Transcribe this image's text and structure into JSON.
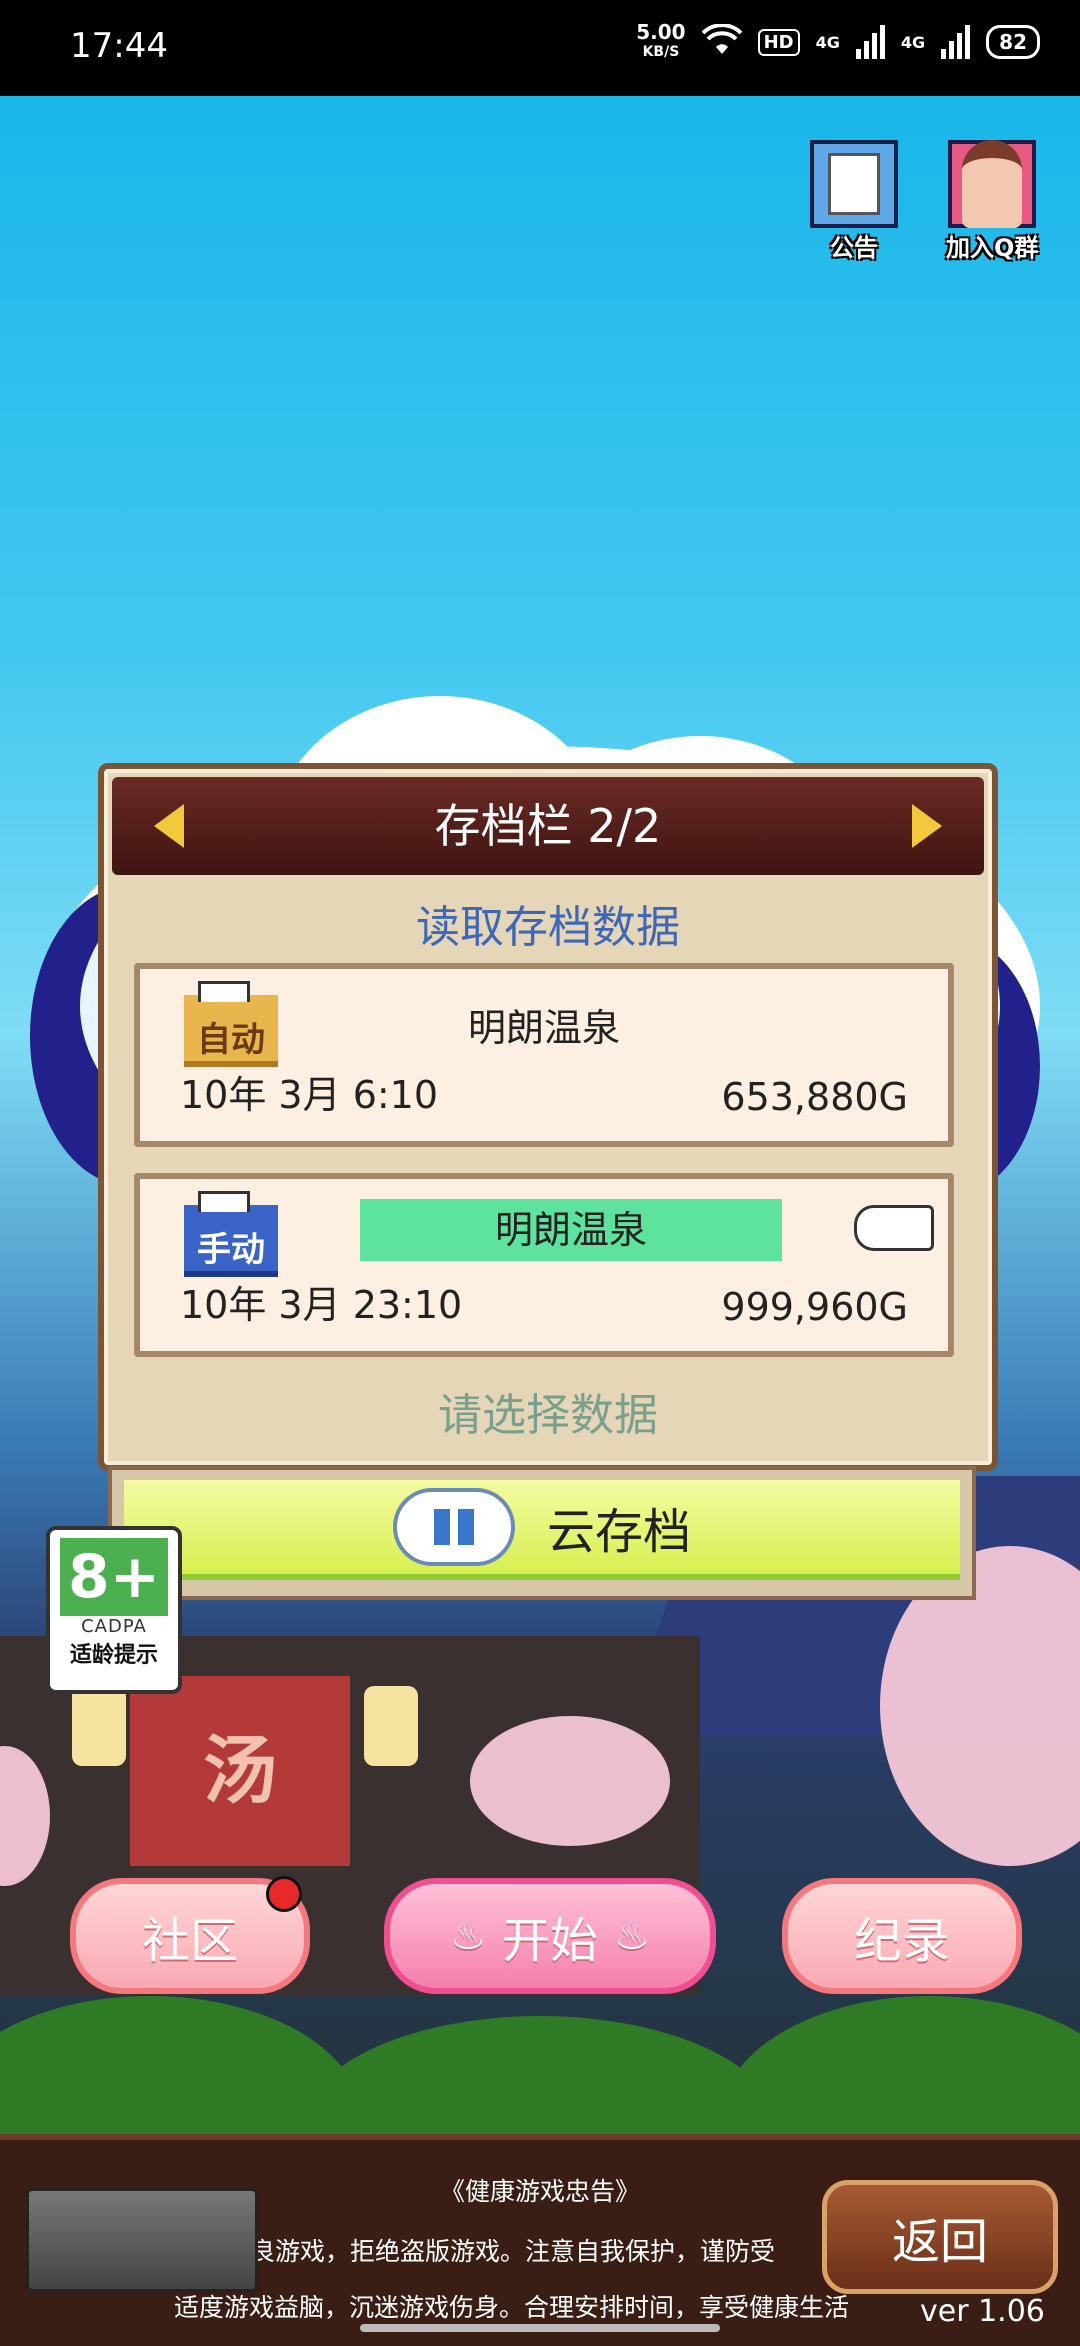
{
  "status_bar": {
    "time": "17:44",
    "net_speed_value": "5.00",
    "net_speed_unit": "KB/S",
    "hd_label": "HD",
    "signal_1": "4G",
    "signal_2": "4G",
    "battery": "82"
  },
  "top_icons": {
    "announcement_label": "公告",
    "join_qq_label": "加入Q群"
  },
  "save_panel": {
    "title": "存档栏 2/2",
    "subtitle": "读取存档数据",
    "slots": [
      {
        "badge": "自动",
        "name": "明朗温泉",
        "date": "10年 3月   6:10",
        "money": "653,880G"
      },
      {
        "badge": "手动",
        "name": "明朗温泉",
        "date": "10年 3月 23:10",
        "money": "999,960G"
      }
    ],
    "prompt": "请选择数据"
  },
  "cloud_save": {
    "label": "云存档"
  },
  "age_rating": {
    "value": "8+",
    "org": "CADPA",
    "tip": "适龄提示"
  },
  "scene": {
    "noren_char": "汤"
  },
  "menu": {
    "community": "社区",
    "start": "开始",
    "records": "纪录"
  },
  "notice": {
    "title": "《健康游戏忠告》",
    "line2": "良游戏，拒绝盗版游戏。注意自我保护，谨防受",
    "line3": "适度游戏益脑，沉迷游戏伤身。合理安排时间，享受健康生活"
  },
  "back_button": "返回",
  "version": "ver 1.06"
}
